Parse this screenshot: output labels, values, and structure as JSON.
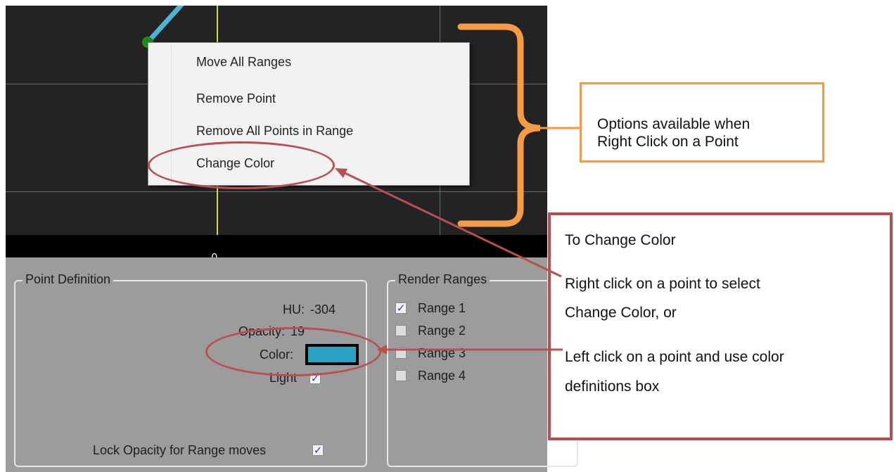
{
  "graph": {
    "axis_zero_label": "0"
  },
  "context_menu": {
    "items": [
      {
        "label": "Move All Ranges"
      },
      {
        "label": "Remove Point"
      },
      {
        "label": "Remove All Points in Range"
      },
      {
        "label": "Change Color"
      }
    ]
  },
  "point_definition": {
    "title": "Point Definition",
    "hu_label": "HU:",
    "hu_value": "-304",
    "opacity_label": "Opacity:",
    "opacity_value": "19",
    "color_label": "Color:",
    "color_value": "#2aa2c4",
    "light_label": "Light",
    "light_checked": true,
    "lock_opacity_label": "Lock Opacity for Range moves",
    "lock_opacity_checked": true
  },
  "render_ranges": {
    "title": "Render Ranges",
    "ranges": [
      {
        "label": "Range 1",
        "checked": true
      },
      {
        "label": "Range 2",
        "checked": false
      },
      {
        "label": "Range 3",
        "checked": false
      },
      {
        "label": "Range 4",
        "checked": false
      }
    ]
  },
  "annotations": {
    "options_callout": {
      "line1": "Options available when",
      "line2": "Right Click on a Point"
    },
    "change_color_callout": {
      "heading": "To Change Color",
      "line1": "Right click on a point to select",
      "line2": "Change Color, or",
      "line3": "Left click on a point and use color",
      "line4": "definitions box"
    }
  },
  "colors": {
    "curve": "#4fb3d3",
    "point": "#1e8a1e",
    "bracket": "#f59a45",
    "annotation_red": "#b9504f"
  }
}
